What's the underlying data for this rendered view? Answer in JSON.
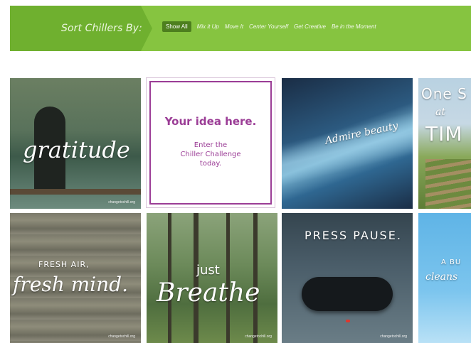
{
  "header": {
    "sort_label": "Sort Chillers By:",
    "filters": [
      "Show All",
      "Mix it Up",
      "Move It",
      "Center Yourself",
      "Get Creative",
      "Be in the Moment"
    ],
    "active_filter": "Show All"
  },
  "tiles": [
    {
      "text": "gratitude",
      "credit": "changetochill.org"
    },
    {
      "title": "Your idea here.",
      "subtitle_lines": [
        "Enter the",
        "Chiller Challenge",
        "today."
      ]
    },
    {
      "text": "Admire beauty"
    },
    {
      "text_lines": [
        "One S",
        "at",
        "TIM"
      ]
    },
    {
      "text_lines": [
        "FRESH AIR,",
        "fresh mind."
      ],
      "credit": "changetochill.org"
    },
    {
      "text_lines": [
        "just",
        "Breathe"
      ],
      "credit": "changetochill.org"
    },
    {
      "text": "PRESS PAUSE.",
      "credit": "changetochill.org"
    },
    {
      "text_lines": [
        "A BU",
        "cleans"
      ]
    }
  ],
  "colors": {
    "bar_green": "#86c440",
    "bar_dark_green": "#6fb02f",
    "active_filter_bg": "#4d7f1e",
    "idea_purple": "#9b3d96"
  }
}
